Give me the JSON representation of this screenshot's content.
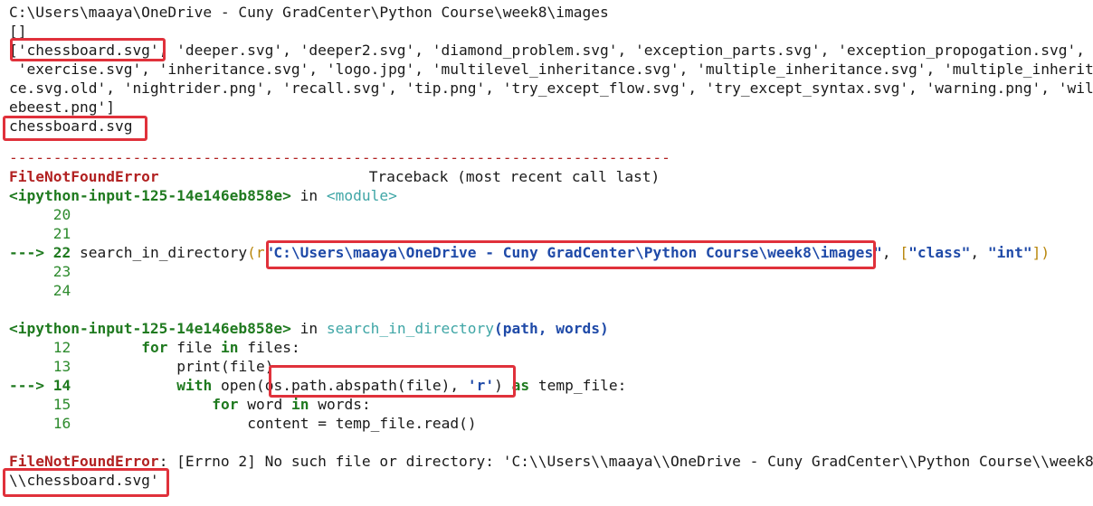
{
  "output": {
    "cwd": "C:\\Users\\maaya\\OneDrive - Cuny GradCenter\\Python Course\\week8\\images",
    "empty_list": "[]",
    "files_line1": "['chessboard.svg', 'deeper.svg', 'deeper2.svg', 'diamond_problem.svg', 'exception_parts.svg', 'exception_propogation.svg',",
    "files_line2": " 'exercise.svg', 'inheritance.svg', 'logo.jpg', 'multilevel_inheritance.svg', 'multiple_inheritance.svg', 'multiple_inheritan",
    "files_line3": "ce.svg.old', 'nightrider.png', 'recall.svg', 'tip.png', 'try_except_flow.svg', 'try_except_syntax.svg', 'warning.png', 'wild",
    "files_line4": "ebeest.png']",
    "printed_file": "chessboard.svg"
  },
  "traceback": {
    "separator": "---------------------------------------------------------------------------",
    "error_name": "FileNotFoundError",
    "header_right": "Traceback (most recent call last)",
    "frame1": {
      "location": "<ipython-input-125-14e146eb858e>",
      "in_word": " in ",
      "module": "<module>",
      "lines": [
        {
          "num": "     20",
          "code": ""
        },
        {
          "num": "     21",
          "code": ""
        },
        {
          "arrow": "---> 22",
          "func": " search_in_directory",
          "open": "(r",
          "path_str": "\"C:\\Users\\maaya\\OneDrive - Cuny GradCenter\\Python Course\\week8\\images\"",
          "rest_sep": ", ",
          "list_open": "[",
          "s1": "\"class\"",
          "comma": ", ",
          "s2": "\"int\"",
          "close": "])"
        },
        {
          "num": "     23",
          "code": ""
        },
        {
          "num": "     24",
          "code": ""
        }
      ]
    },
    "frame2": {
      "location": "<ipython-input-125-14e146eb858e>",
      "in_word": " in ",
      "func": "search_in_directory",
      "args": "(path, words)",
      "l12_num": "     12",
      "l12_kw1": "for",
      "l12_var": " file ",
      "l12_kw2": "in",
      "l12_rest": " files:",
      "l13_num": "     13",
      "l13_code": "print(file)",
      "l14_arrow": "---> 14",
      "l14_kw": "with",
      "l14_open": " open(",
      "l14_os": "os.path.abspath(file), ",
      "l14_r": "'r'",
      "l14_close": ")",
      "l14_as": " as",
      "l14_rest": " temp_file:",
      "l15_num": "     15",
      "l15_kw1": "for",
      "l15_var": " word ",
      "l15_kw2": "in",
      "l15_rest": " words:",
      "l16_num": "     16",
      "l16_code": "content = temp_file.read()"
    },
    "final_error_name": "FileNotFoundError",
    "final_error_msg": ": [Errno 2] No such file or directory: 'C:\\\\Users\\\\maaya\\\\OneDrive - Cuny GradCenter\\\\Python Course\\\\week8",
    "final_error_msg2": "\\\\chessboard.svg'"
  },
  "colors": {
    "highlight": "#e0313b",
    "error": "#b22222",
    "keyword": "#1f7a1f",
    "string": "#1f4aa8",
    "module_link": "#3fa6a6"
  }
}
